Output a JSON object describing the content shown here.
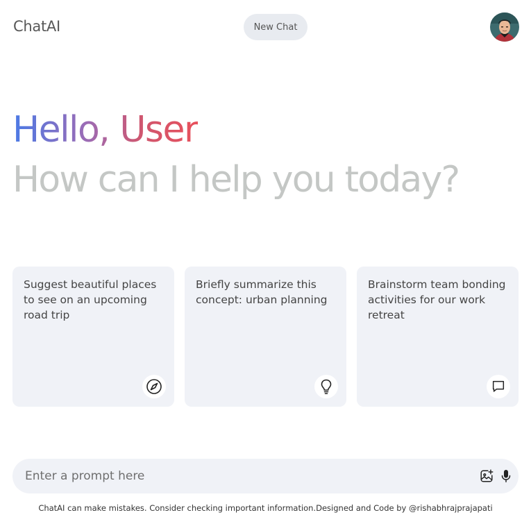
{
  "header": {
    "brand": "ChatAI",
    "new_chat_label": "New Chat",
    "avatar_icon": "user-avatar"
  },
  "greeting": {
    "hello": "Hello, User",
    "subtitle": "How can I help you today?"
  },
  "cards": [
    {
      "text": "Suggest beautiful places to see on an upcoming road trip",
      "icon": "compass-icon"
    },
    {
      "text": "Briefly summarize this concept: urban planning",
      "icon": "lightbulb-icon"
    },
    {
      "text": "Brainstorm team bonding activities for our work retreat",
      "icon": "message-icon"
    }
  ],
  "prompt": {
    "placeholder": "Enter a prompt here",
    "value": "",
    "icons": [
      "add-image-icon",
      "mic-icon"
    ]
  },
  "footer": {
    "text": "ChatAI can make mistakes. Consider checking important information.Designed and Code by @rishabhrajprajapati"
  },
  "colors": {
    "gradient": [
      "#4b7ae6",
      "#9c6cb5",
      "#d0566e",
      "#e8505b"
    ],
    "subtitle": "#c4c7c5",
    "card_bg": "#f0f2f7",
    "button_bg": "#e8ebf0"
  }
}
